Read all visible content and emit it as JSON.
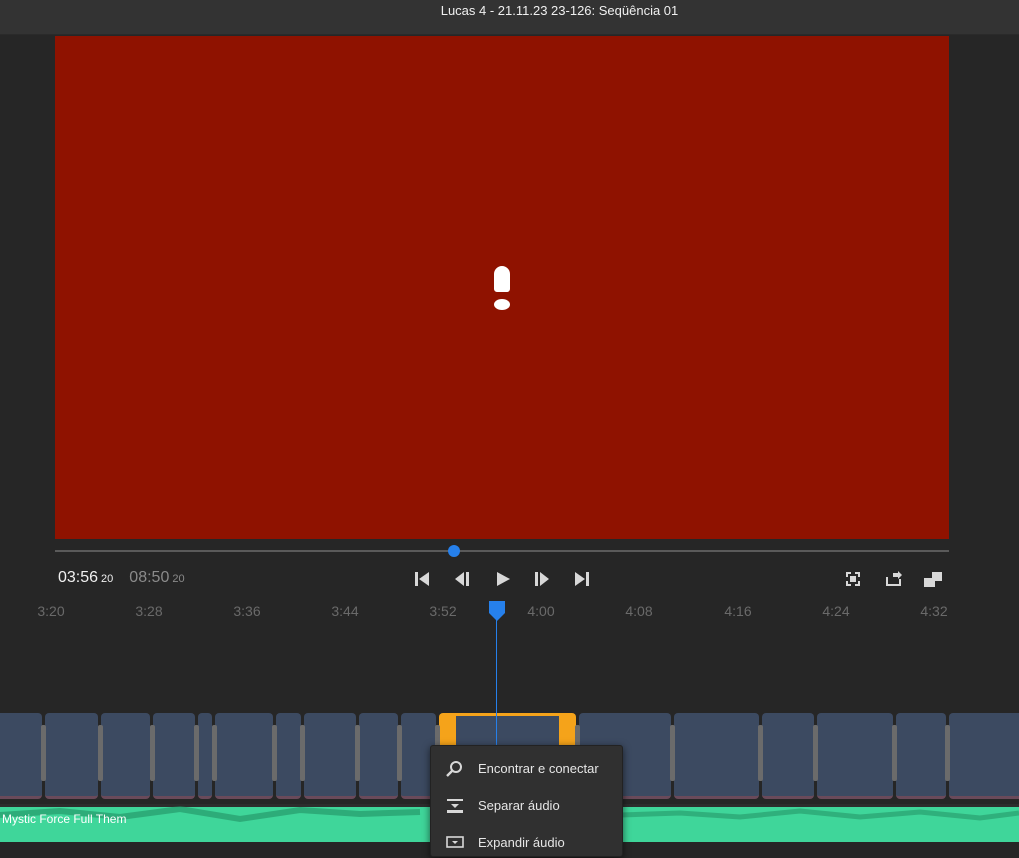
{
  "window": {
    "title": "Lucas 4 - 21.11.23 23-126: Seqüência 01"
  },
  "viewer": {
    "background": "#8f1200",
    "warning_icon": "exclamation-icon"
  },
  "playback": {
    "current_time": "03:56",
    "current_frames": "20",
    "duration": "08:50",
    "duration_frames": "20",
    "position_fraction": 0.445
  },
  "transport": {
    "go_to_start": "skip-to-start-icon",
    "step_back": "step-back-icon",
    "play": "play-icon",
    "step_forward": "step-forward-icon",
    "go_to_end": "skip-to-end-icon"
  },
  "viewer_tools": {
    "fit": "fit-frame-icon",
    "export_frame": "export-frame-icon",
    "window_mode": "window-mode-icon"
  },
  "ruler": {
    "labels": [
      "3:20",
      "3:28",
      "3:36",
      "3:44",
      "3:52",
      "4:00",
      "4:08",
      "4:16",
      "4:24",
      "4:32"
    ]
  },
  "timeline": {
    "playhead_color": "#2680eb",
    "selected_clip_color": "#f5a31a",
    "audio_clip": {
      "label": "Mystic Force Full Them",
      "color": "#3fd69a"
    }
  },
  "context_menu": {
    "items": [
      {
        "icon": "search-icon",
        "label": "Encontrar e conectar"
      },
      {
        "icon": "split-audio-icon",
        "label": "Separar áudio"
      },
      {
        "icon": "expand-audio-icon",
        "label": "Expandir áudio"
      }
    ]
  }
}
